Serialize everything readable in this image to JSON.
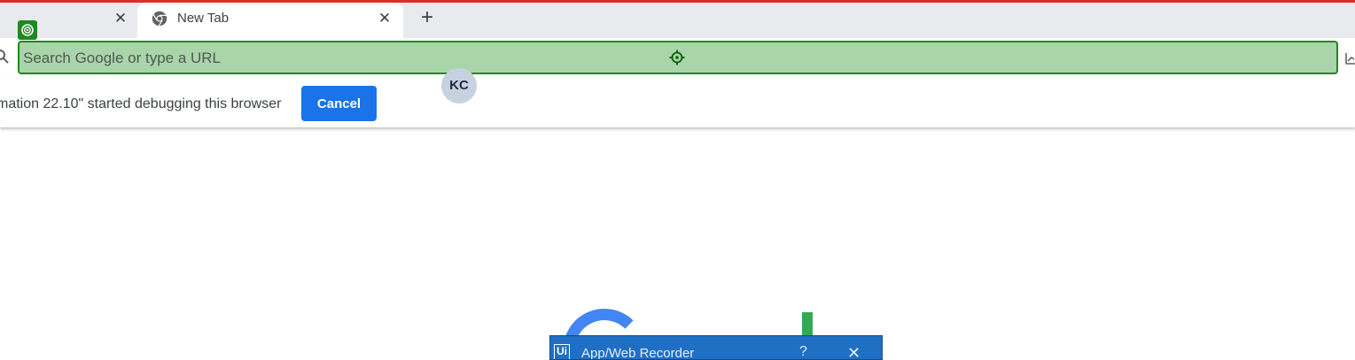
{
  "tabs": {
    "close_glyph": "✕",
    "active_title": "New Tab",
    "new_tab_glyph": "+"
  },
  "omnibox": {
    "placeholder": "Search Google or type a URL",
    "value": ""
  },
  "infobar": {
    "message": "mation 22.10\" started debugging this browser",
    "cancel_label": "Cancel"
  },
  "avatar": {
    "initials": "KC"
  },
  "recorder": {
    "logo": "Ui",
    "title": "App/Web Recorder",
    "help_glyph": "?",
    "close_glyph": "✕"
  },
  "colors": {
    "highlight_fill": "#aad4aa",
    "highlight_border": "#1e8a1e",
    "cancel_button": "#1a73e8",
    "top_border": "#d93025",
    "recorder_bar": "#1f6fc5"
  },
  "icons": {
    "favicon": "chrome-icon",
    "target": "crosshair-target-icon",
    "badge": "target-badge-icon",
    "search": "search-icon"
  }
}
